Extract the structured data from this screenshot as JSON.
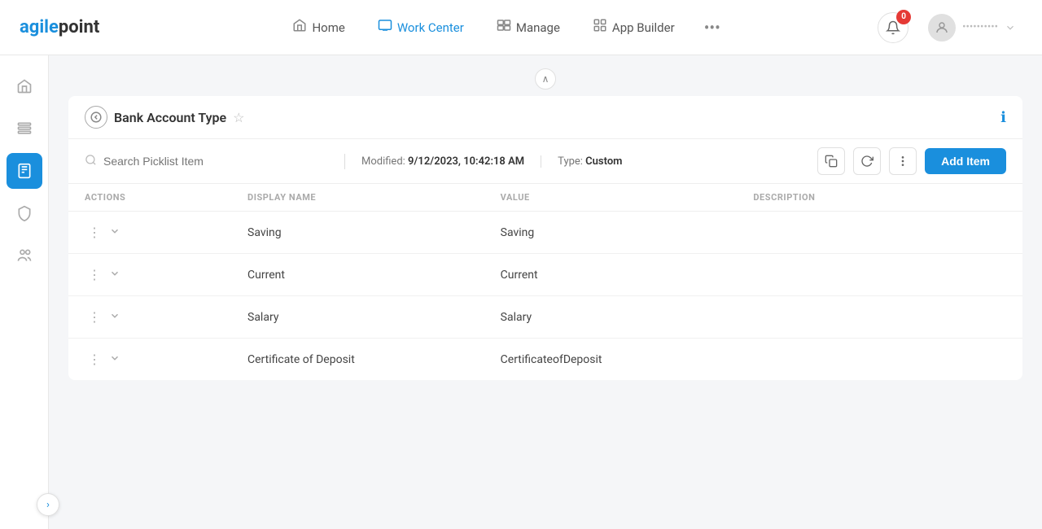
{
  "logo": {
    "text_a": "agile",
    "text_b": "point"
  },
  "nav": {
    "links": [
      {
        "id": "home",
        "label": "Home",
        "icon": "⌂"
      },
      {
        "id": "work-center",
        "label": "Work Center",
        "icon": "🖥"
      },
      {
        "id": "manage",
        "label": "Manage",
        "icon": "💼"
      },
      {
        "id": "app-builder",
        "label": "App Builder",
        "icon": "⊞"
      }
    ],
    "more_icon": "•••",
    "notification_count": "0",
    "user_name": "••••••••••"
  },
  "sidebar": {
    "items": [
      {
        "id": "home-nav",
        "icon": "⌂",
        "active": false
      },
      {
        "id": "list-nav",
        "icon": "☰",
        "active": false
      },
      {
        "id": "doc-nav",
        "icon": "📄",
        "active": true
      },
      {
        "id": "shield-nav",
        "icon": "🛡",
        "active": false
      },
      {
        "id": "users-nav",
        "icon": "👥",
        "active": false
      }
    ],
    "expand_icon": "›"
  },
  "page": {
    "back_label": "←",
    "title": "Bank Account Type",
    "modified_label": "Modified:",
    "modified_value": "9/12/2023, 10:42:18 AM",
    "type_label": "Type:",
    "type_value": "Custom",
    "search_placeholder": "Search Picklist Item",
    "add_item_label": "Add Item"
  },
  "table": {
    "columns": [
      "ACTIONS",
      "DISPLAY NAME",
      "VALUE",
      "DESCRIPTION"
    ],
    "rows": [
      {
        "display_name": "Saving",
        "value": "Saving",
        "description": ""
      },
      {
        "display_name": "Current",
        "value": "Current",
        "description": ""
      },
      {
        "display_name": "Salary",
        "value": "Salary",
        "description": ""
      },
      {
        "display_name": "Certificate of Deposit",
        "value": "CertificateofDeposit",
        "description": ""
      }
    ]
  }
}
